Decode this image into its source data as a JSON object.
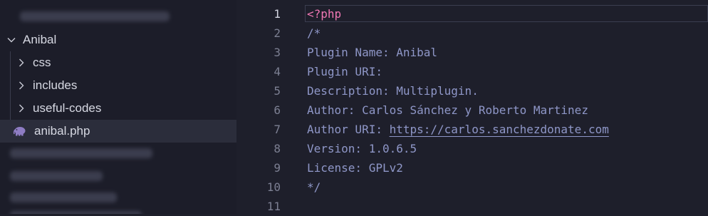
{
  "explorer": {
    "blurred_top_label": "elementor-custom-fields",
    "folder": {
      "name": "Anibal",
      "children": [
        {
          "name": "css",
          "type": "folder"
        },
        {
          "name": "includes",
          "type": "folder"
        },
        {
          "name": "useful-codes",
          "type": "folder"
        },
        {
          "name": "anibal.php",
          "type": "file",
          "icon": "php-elephant-icon"
        }
      ]
    },
    "blurred_bottom_labels": [
      "better-search-replace",
      "classic-editor",
      "contact-form-7",
      "duplicate-post"
    ]
  },
  "editor": {
    "current_line": 1,
    "line_numbers": [
      "1",
      "2",
      "3",
      "4",
      "5",
      "6",
      "7",
      "8",
      "9",
      "10",
      "11"
    ],
    "lines": {
      "l1": "<?php",
      "l2": "/*",
      "l3": "Plugin Name: Anibal",
      "l4": "Plugin URI:",
      "l5": "Description: Multiplugin.",
      "l6": "Author: Carlos Sánchez y Roberto Martinez",
      "l7_label": "Author URI: ",
      "l7_url": "https://carlos.sanchezdonate.com",
      "l8": "Version: 1.0.6.5",
      "l9": "License: GPLv2",
      "l10": "*/",
      "l11": ""
    }
  },
  "colors": {
    "background": "#1e1f2b",
    "comment": "#8f97c8",
    "php_tag": "#f078b4",
    "line_number": "#7c7f92"
  }
}
